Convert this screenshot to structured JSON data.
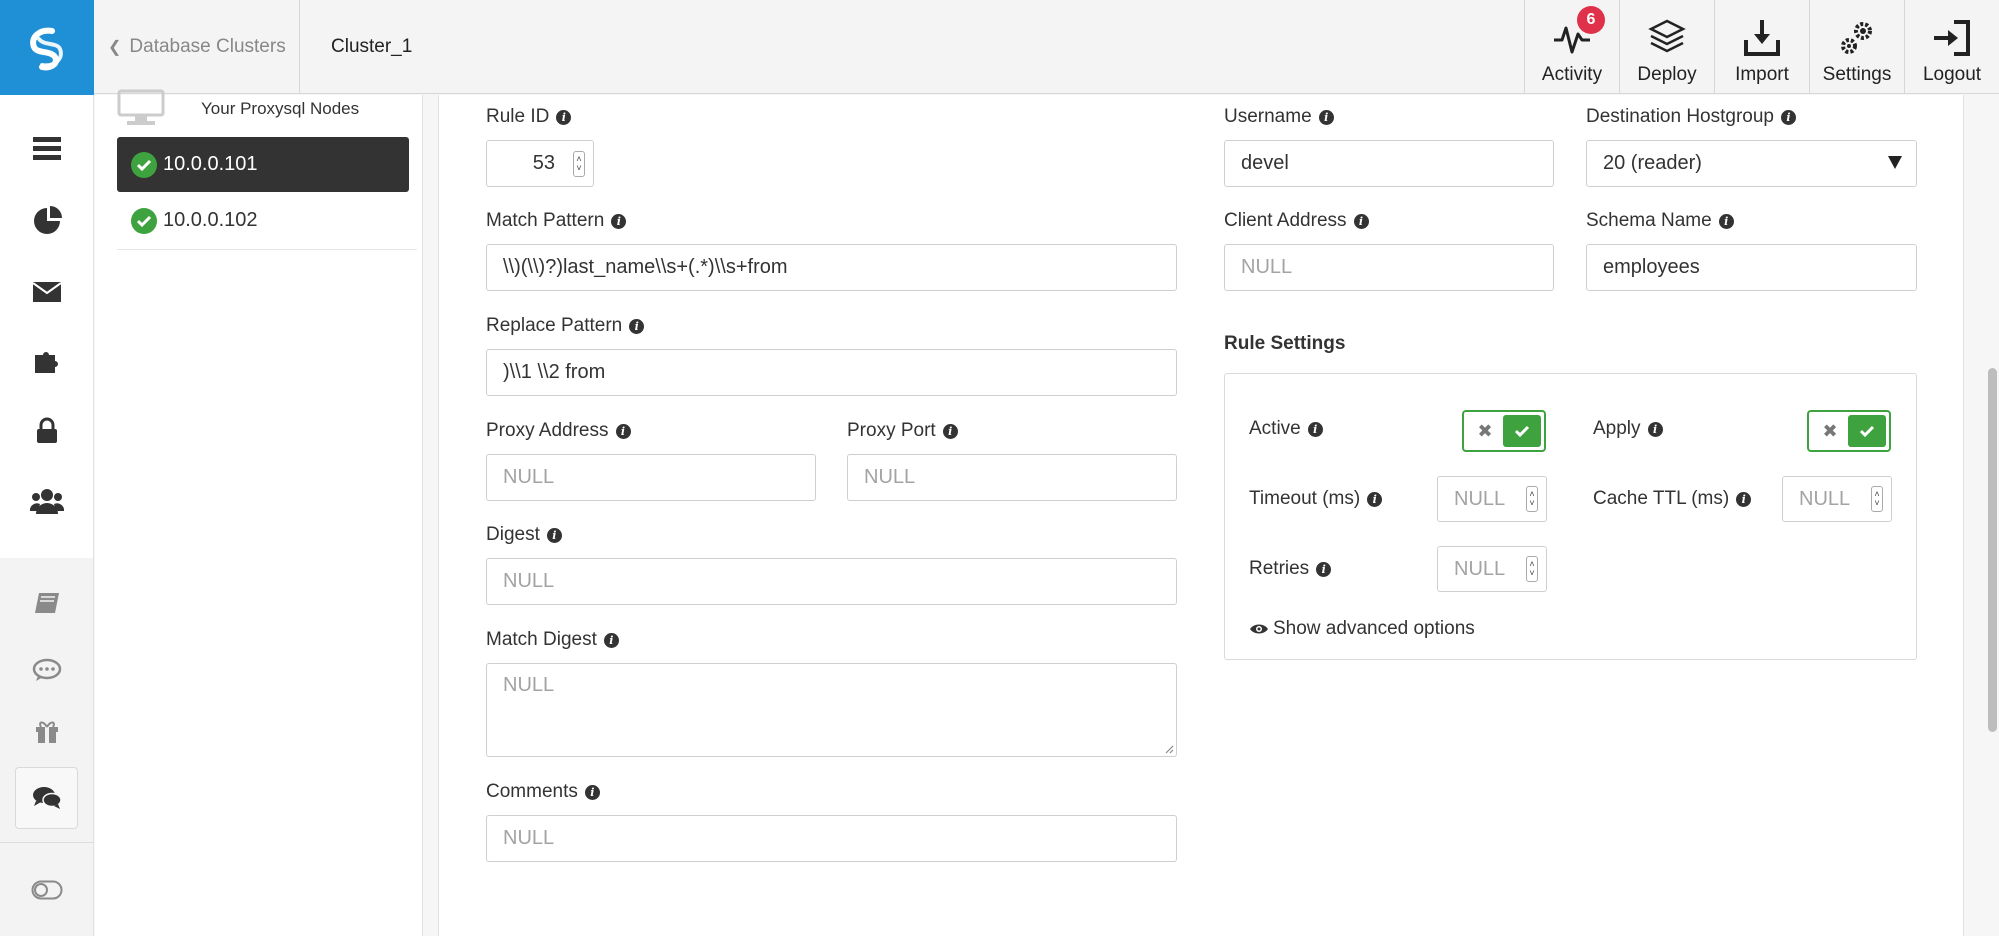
{
  "header": {
    "breadcrumb": "Database Clusters",
    "cluster_name": "Cluster_1",
    "nav": [
      {
        "label": "Activity",
        "badge": "6"
      },
      {
        "label": "Deploy"
      },
      {
        "label": "Import"
      },
      {
        "label": "Settings"
      },
      {
        "label": "Logout"
      }
    ]
  },
  "nodes": {
    "heading": "Your Proxysql Nodes",
    "items": [
      {
        "label": "10.0.0.101",
        "status": "ok",
        "selected": true
      },
      {
        "label": "10.0.0.102",
        "status": "ok",
        "selected": false
      }
    ]
  },
  "form": {
    "rule_id": {
      "label": "Rule ID",
      "value": "53"
    },
    "match_pattern": {
      "label": "Match Pattern",
      "value": "\\\\)(\\\\)?)last_name\\\\s+(.*)\\\\s+from"
    },
    "replace_pattern": {
      "label": "Replace Pattern",
      "value": ")\\\\1 \\\\2 from"
    },
    "proxy_address": {
      "label": "Proxy Address",
      "placeholder": "NULL"
    },
    "proxy_port": {
      "label": "Proxy Port",
      "placeholder": "NULL"
    },
    "digest": {
      "label": "Digest",
      "placeholder": "NULL"
    },
    "match_digest": {
      "label": "Match Digest",
      "placeholder": "NULL"
    },
    "comments": {
      "label": "Comments",
      "placeholder": "NULL"
    },
    "username": {
      "label": "Username",
      "value": "devel"
    },
    "destination_hostgroup": {
      "label": "Destination Hostgroup",
      "value": "20 (reader)"
    },
    "client_address": {
      "label": "Client Address",
      "placeholder": "NULL"
    },
    "schema_name": {
      "label": "Schema Name",
      "value": "employees"
    }
  },
  "rule_settings": {
    "title": "Rule Settings",
    "active": {
      "label": "Active",
      "on": true
    },
    "apply": {
      "label": "Apply",
      "on": true
    },
    "timeout": {
      "label": "Timeout (ms)",
      "placeholder": "NULL"
    },
    "cache_ttl": {
      "label": "Cache TTL (ms)",
      "placeholder": "NULL"
    },
    "retries": {
      "label": "Retries",
      "placeholder": "NULL"
    },
    "advanced_link": "Show advanced options"
  },
  "colors": {
    "brand": "#1f8fd6",
    "success": "#3ea33e",
    "badge": "#e0314b",
    "selected_node_bg": "#333333"
  },
  "icons": [
    "logo-icon",
    "activity-icon",
    "deploy-icon",
    "import-icon",
    "settings-icon",
    "logout-icon",
    "clusters-icon",
    "dashboard-icon",
    "mail-icon",
    "puzzle-icon",
    "lock-icon",
    "users-icon",
    "book-icon",
    "comment-icon",
    "gift-icon",
    "chat-icon",
    "toggle-icon",
    "eye-icon",
    "info-icon",
    "check-icon"
  ]
}
